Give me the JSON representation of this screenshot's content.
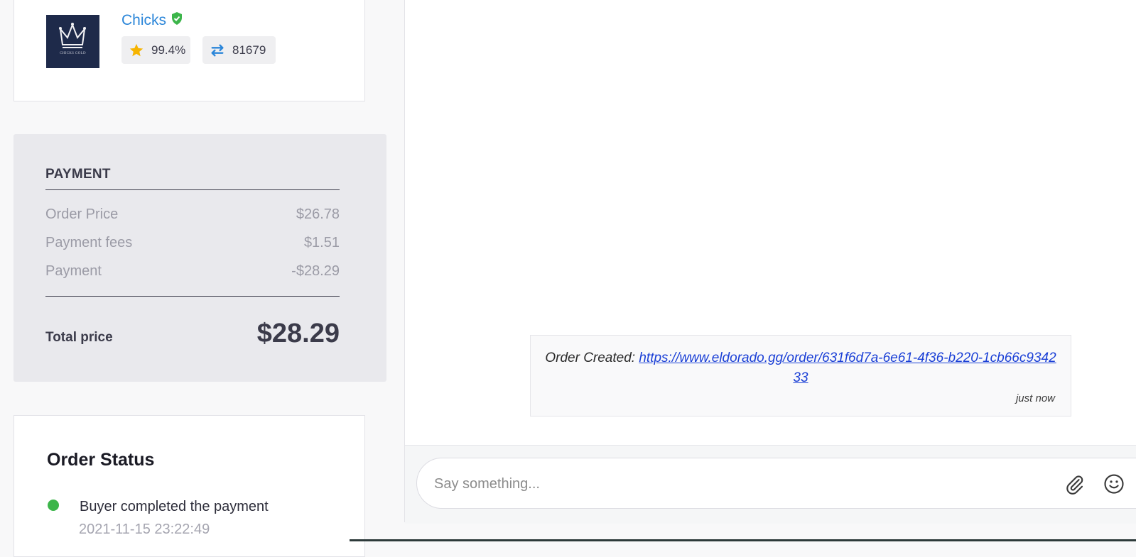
{
  "seller": {
    "name": "Chicks",
    "avatar_brand": "CHICKS GOLD",
    "rating": "99.4%",
    "trades": "81679",
    "verified_icon": "verified-shield-icon",
    "rating_icon": "star-icon",
    "trades_icon": "swap-arrows-icon"
  },
  "payment": {
    "title": "PAYMENT",
    "rows": [
      {
        "label": "Order Price",
        "value": "$26.78"
      },
      {
        "label": "Payment fees",
        "value": "$1.51"
      },
      {
        "label": "Payment",
        "value": "-$28.29"
      }
    ],
    "total_label": "Total price",
    "total_value": "$28.29"
  },
  "order_status": {
    "title": "Order Status",
    "events": [
      {
        "text": "Buyer completed the payment",
        "time": "2021-11-15 23:22:49",
        "color": "#3cb54a"
      }
    ]
  },
  "chat": {
    "messages": [
      {
        "prefix": "Order Created: ",
        "link": "https://www.eldorado.gg/order/631f6d7a-6e61-4f36-b220-1cb66c934233",
        "time": "just now"
      }
    ],
    "composer_placeholder": "Say something...",
    "attach_icon": "paperclip-icon",
    "emoji_icon": "smiley-icon"
  },
  "colors": {
    "accent_blue": "#2b86d9",
    "star": "#f6b400",
    "verified_green": "#3cb54a",
    "link": "#1a3fd6"
  }
}
